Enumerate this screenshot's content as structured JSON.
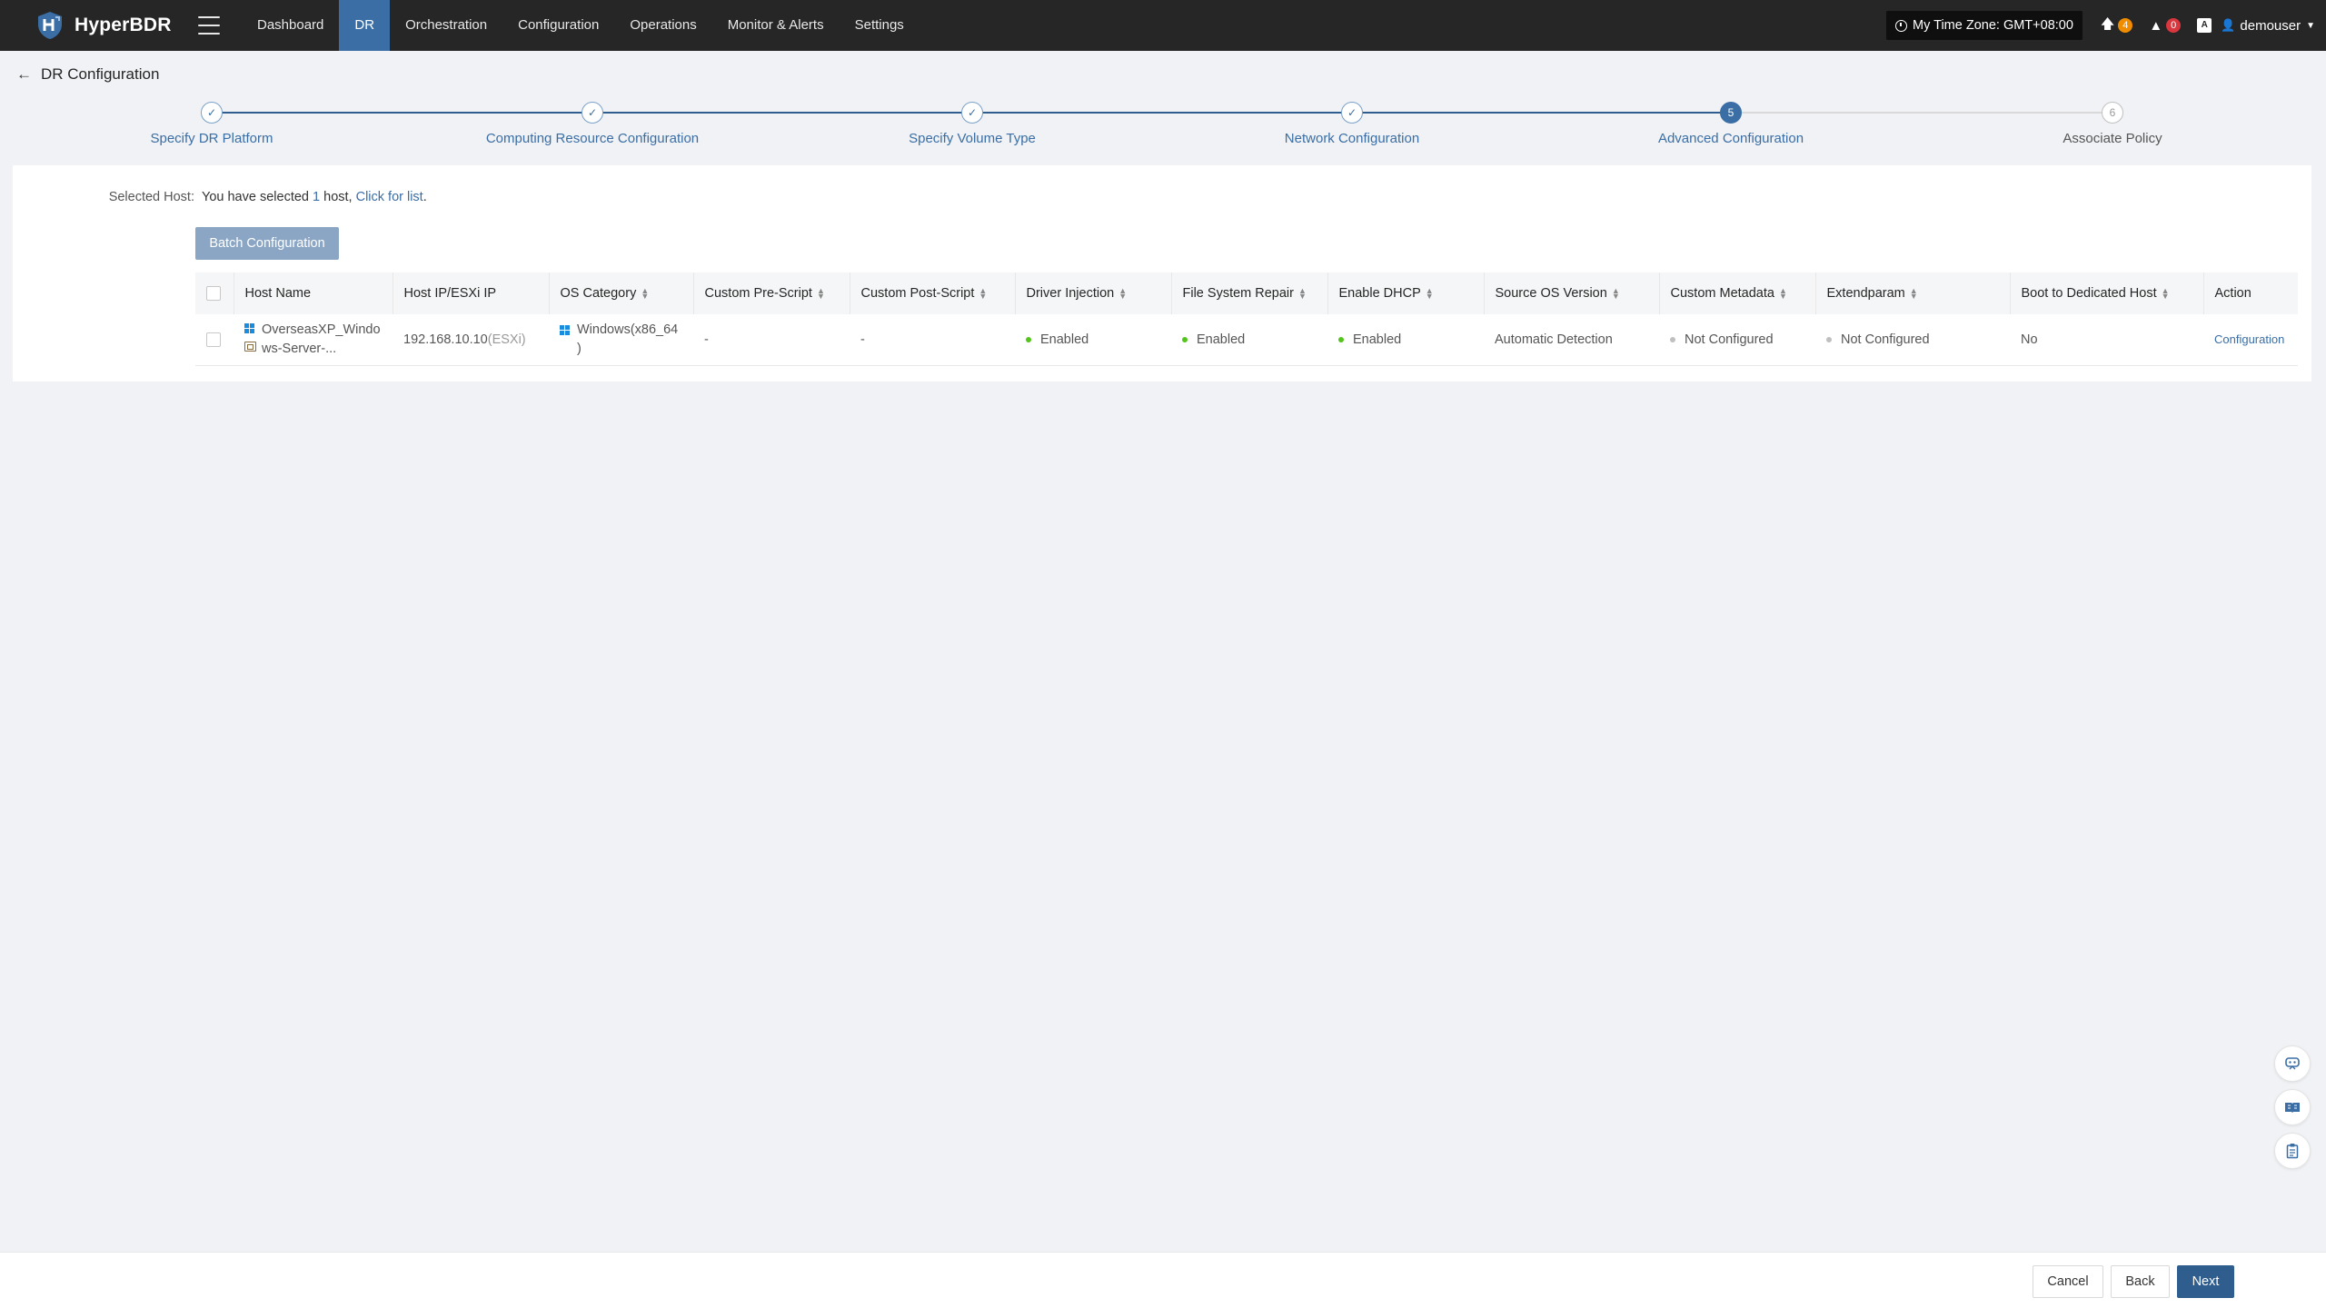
{
  "app": {
    "name": "HyperBDR"
  },
  "nav": {
    "items": [
      "Dashboard",
      "DR",
      "Orchestration",
      "Configuration",
      "Operations",
      "Monitor & Alerts",
      "Settings"
    ],
    "active": "DR"
  },
  "header": {
    "timezone": "My Time Zone: GMT+08:00",
    "upload_count": "4",
    "alert_count": "0",
    "lang_label": "A",
    "user": "demouser"
  },
  "page": {
    "title": "DR Configuration"
  },
  "steps": [
    {
      "label": "Specify DR Platform",
      "state": "done",
      "marker": "✓"
    },
    {
      "label": "Computing Resource Configuration",
      "state": "done",
      "marker": "✓"
    },
    {
      "label": "Specify Volume Type",
      "state": "done",
      "marker": "✓"
    },
    {
      "label": "Network Configuration",
      "state": "done",
      "marker": "✓"
    },
    {
      "label": "Advanced Configuration",
      "state": "current",
      "marker": "5"
    },
    {
      "label": "Associate Policy",
      "state": "todo",
      "marker": "6"
    }
  ],
  "selection": {
    "label": "Selected Host:",
    "prefix": "You have selected",
    "count": "1",
    "suffix": "host,",
    "link": "Click for list",
    "end": "."
  },
  "batch_button": "Batch Configuration",
  "table": {
    "headers": [
      "Host Name",
      "Host IP/ESXi IP",
      "OS Category",
      "Custom Pre-Script",
      "Custom Post-Script",
      "Driver Injection",
      "File System Repair",
      "Enable DHCP",
      "Source OS Version",
      "Custom Metadata",
      "Extendparam",
      "Boot to Dedicated Host",
      "Action"
    ],
    "rows": [
      {
        "host_name_line1": "OverseasXP_Windo",
        "host_name_line2": "ws-Server-...",
        "ip": "192.168.10.10",
        "ip_note": "(ESXi)",
        "os_line1": "Windows(x86_64",
        "os_line2": ")",
        "pre_script": "-",
        "post_script": "-",
        "driver_injection": "Enabled",
        "fs_repair": "Enabled",
        "dhcp": "Enabled",
        "source_os": "Automatic Detection",
        "metadata": "Not Configured",
        "extendparam": "Not Configured",
        "boot_dedicated": "No",
        "action": "Configuration"
      }
    ]
  },
  "icons": {
    "status_enabled_color": "#52c41a",
    "status_not_configured_color": "#bfbfbf",
    "accent": "#3a6ea5"
  },
  "footer": {
    "cancel": "Cancel",
    "back": "Back",
    "next": "Next"
  }
}
